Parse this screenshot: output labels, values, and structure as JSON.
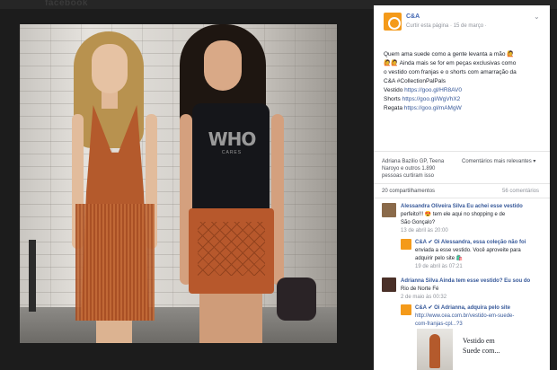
{
  "topbar": {
    "logo_text": "facebook"
  },
  "photo": {
    "tee_text": "WHO",
    "tee_sub": "CARES"
  },
  "post": {
    "page_name": "C&A",
    "meta": "Curtir esta página · 15 de março · ",
    "lines": [
      "Quem ama suede como a gente levanta a mão 🙋",
      "🙋🙋 Ainda mais se for em peças exclusivas como",
      "o vestido com franjas e o shorts com amarração da",
      "C&A #CollectionPalPals"
    ],
    "links": [
      {
        "label": "Vestido",
        "url": "https://goo.gl/HR8AV0"
      },
      {
        "label": "Shorts",
        "url": "https://goo.gl/WgVhX2"
      },
      {
        "label": "Regata",
        "url": "https://goo.gl/mAMgW"
      }
    ]
  },
  "reactions": {
    "likes_lines": [
      "Adriana Bazilio GP, Teena",
      "Naroyo e outros 1.890",
      "pessoas curtiram isso"
    ],
    "sort_label": "Comentários mais relevantes ▾",
    "shares": "20 compartilhamentos",
    "comments_count": "56 comentários"
  },
  "comments": [
    {
      "author": "Alessandra Oliveira Silva",
      "lines": [
        "Alessandra Oliveira Silva Eu achei esse vestido",
        "perfeito!!! 😍 tem ele aqui no shopping e de",
        "São Gonçalo?"
      ],
      "time": "13 de abril às 20:00",
      "avatar_color": "#8a6a4a"
    },
    {
      "author": "C&A",
      "lines": [
        "C&A ✔ Oi Alessandra, essa coleção não foi",
        "enviada a esse vestido. Você aproveite para",
        "adquirir pelo site 🛍️"
      ],
      "time": "19 de abril às 07:21",
      "avatar_color": "#f49a1a"
    },
    {
      "author": "Adrianna Silva",
      "lines": [
        "Adrianna Silva Ainda tem esse vestido? Eu sou do",
        "Rio de Norte Fé"
      ],
      "time": "2 de maio às 00:32",
      "avatar_color": "#4a3028"
    },
    {
      "author": "C&A",
      "lines": [
        "C&A ✔ Oi Adrianna, adquira pelo site",
        "http://www.cea.com.br/vestido-em-suede-",
        "com-franjas-cpl...?3"
      ],
      "time": "",
      "avatar_color": "#f49a1a"
    }
  ],
  "attachment": {
    "caption_lines": [
      "Vestido em",
      "Suede com..."
    ]
  }
}
